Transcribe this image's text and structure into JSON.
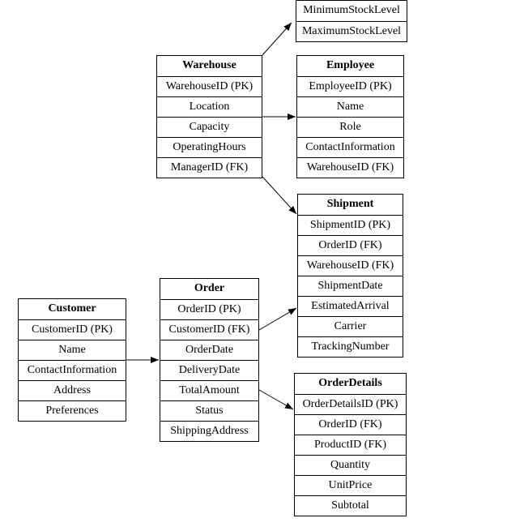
{
  "entities": {
    "stocklevels": {
      "title": "",
      "fields": [
        "MinimumStockLevel",
        "MaximumStockLevel"
      ]
    },
    "warehouse": {
      "title": "Warehouse",
      "fields": [
        "WarehouseID (PK)",
        "Location",
        "Capacity",
        "OperatingHours",
        "ManagerID (FK)"
      ]
    },
    "employee": {
      "title": "Employee",
      "fields": [
        "EmployeeID (PK)",
        "Name",
        "Role",
        "ContactInformation",
        "WarehouseID (FK)"
      ]
    },
    "shipment": {
      "title": "Shipment",
      "fields": [
        "ShipmentID (PK)",
        "OrderID (FK)",
        "WarehouseID (FK)",
        "ShipmentDate",
        "EstimatedArrival",
        "Carrier",
        "TrackingNumber"
      ]
    },
    "customer": {
      "title": "Customer",
      "fields": [
        "CustomerID (PK)",
        "Name",
        "ContactInformation",
        "Address",
        "Preferences"
      ]
    },
    "order": {
      "title": "Order",
      "fields": [
        "OrderID (PK)",
        "CustomerID (FK)",
        "OrderDate",
        "DeliveryDate",
        "TotalAmount",
        "Status",
        "ShippingAddress"
      ]
    },
    "orderdetails": {
      "title": "OrderDetails",
      "fields": [
        "OrderDetailsID (PK)",
        "OrderID (FK)",
        "ProductID (FK)",
        "Quantity",
        "UnitPrice",
        "Subtotal"
      ]
    }
  },
  "relationships": [
    {
      "from": "warehouse",
      "to": "stocklevels"
    },
    {
      "from": "warehouse",
      "to": "employee"
    },
    {
      "from": "warehouse",
      "to": "shipment"
    },
    {
      "from": "customer",
      "to": "order"
    },
    {
      "from": "order",
      "to": "shipment"
    },
    {
      "from": "order",
      "to": "orderdetails"
    }
  ]
}
